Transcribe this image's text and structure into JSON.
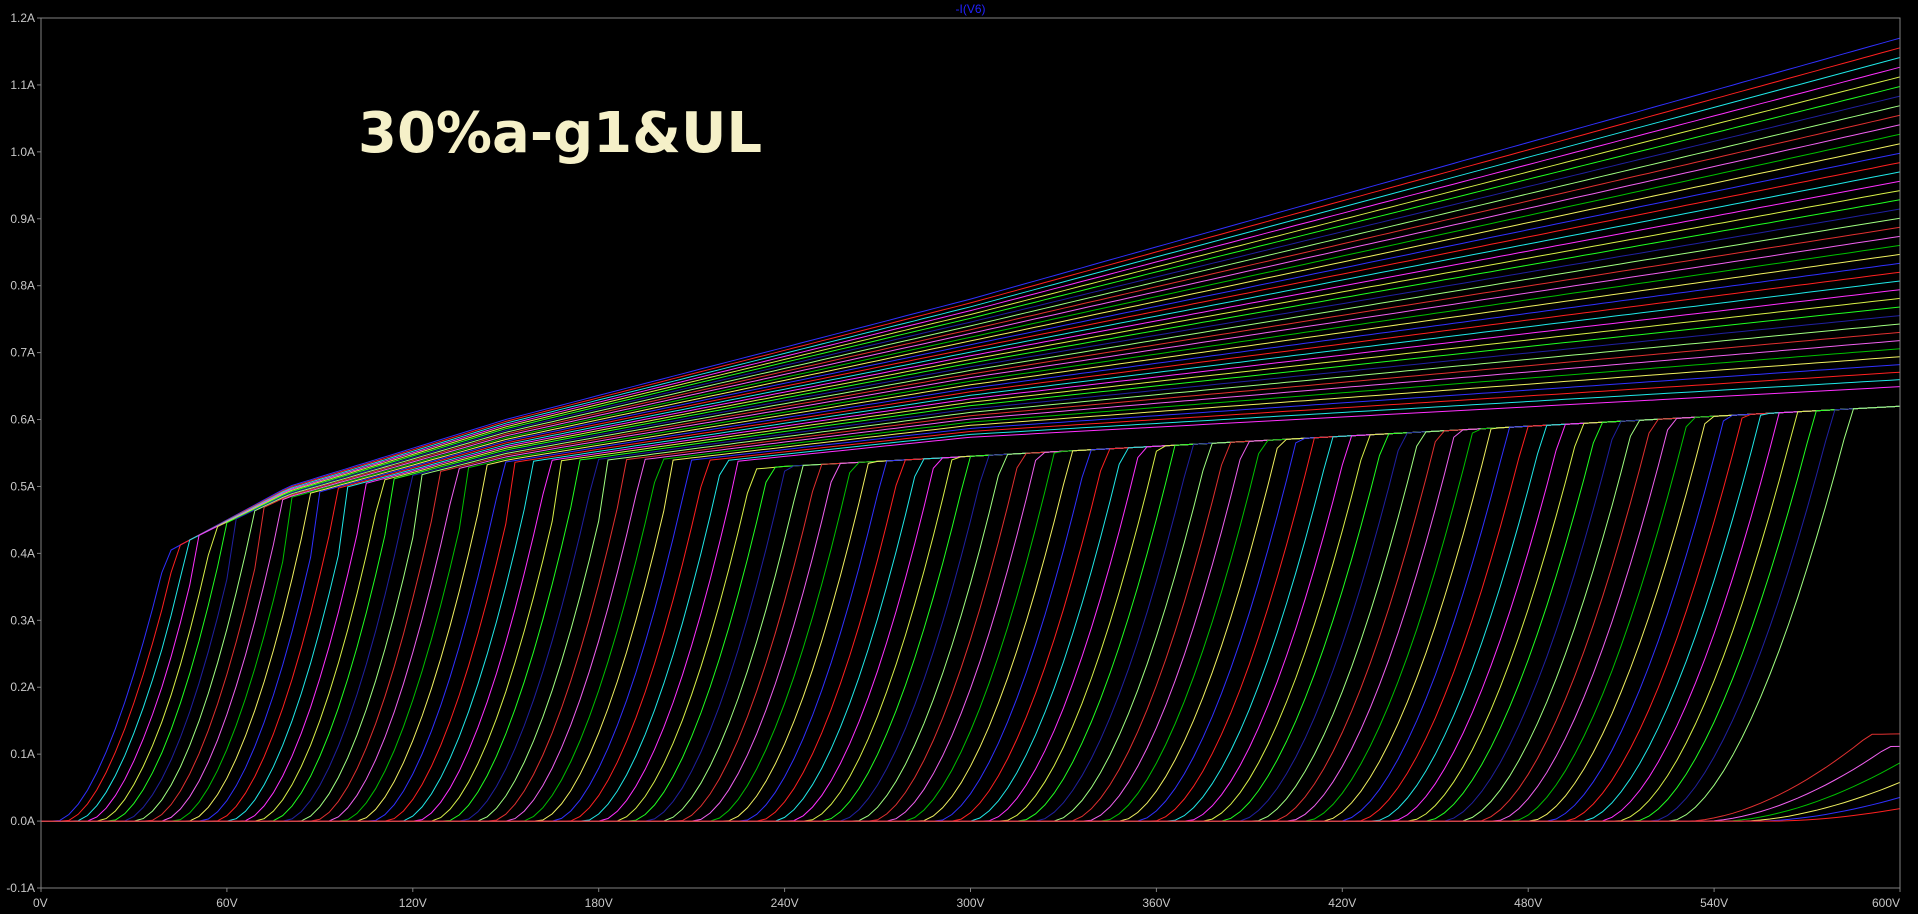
{
  "chart_data": {
    "type": "line",
    "title": "-I(V6)",
    "annotation": "30%a-g1&UL",
    "xlabel": "",
    "ylabel": "",
    "xlim": [
      0,
      600
    ],
    "ylim": [
      -0.1,
      1.2
    ],
    "x_ticks": [
      {
        "value": 0,
        "label": "0V"
      },
      {
        "value": 60,
        "label": "60V"
      },
      {
        "value": 120,
        "label": "120V"
      },
      {
        "value": 180,
        "label": "180V"
      },
      {
        "value": 240,
        "label": "240V"
      },
      {
        "value": 300,
        "label": "300V"
      },
      {
        "value": 360,
        "label": "360V"
      },
      {
        "value": 420,
        "label": "420V"
      },
      {
        "value": 480,
        "label": "480V"
      },
      {
        "value": 540,
        "label": "540V"
      },
      {
        "value": 600,
        "label": "600V"
      }
    ],
    "y_ticks": [
      {
        "value": -0.1,
        "label": "-0.1A"
      },
      {
        "value": 0.0,
        "label": "0.0A"
      },
      {
        "value": 0.1,
        "label": "0.1A"
      },
      {
        "value": 0.2,
        "label": "0.2A"
      },
      {
        "value": 0.3,
        "label": "0.3A"
      },
      {
        "value": 0.4,
        "label": "0.4A"
      },
      {
        "value": 0.5,
        "label": "0.5A"
      },
      {
        "value": 0.6,
        "label": "0.6A"
      },
      {
        "value": 0.7,
        "label": "0.7A"
      },
      {
        "value": 0.8,
        "label": "0.8A"
      },
      {
        "value": 0.9,
        "label": "0.9A"
      },
      {
        "value": 1.0,
        "label": "1.0A"
      },
      {
        "value": 1.1,
        "label": "1.1A"
      },
      {
        "value": 1.2,
        "label": "1.2A"
      }
    ],
    "grid": false,
    "background": "#000000",
    "plot_border_color": "#808080",
    "series_colors": [
      "#3030ff",
      "#ff2020",
      "#20e8e8",
      "#ff30ff",
      "#d8f048",
      "#20ff20",
      "#2020a0",
      "#a0ff80",
      "#e03030",
      "#f060f0",
      "#00c000",
      "#f0f060"
    ],
    "series_model": {
      "count": 110,
      "onset_x_first": 5,
      "onset_x_last": 560,
      "cutoff_curves_from_index": 104,
      "knee": [
        {
          "x": 40,
          "y": 0.39
        },
        {
          "x": 62,
          "y": 0.42
        },
        {
          "x": 120,
          "y": 0.48
        },
        {
          "x": 240,
          "y": 0.53
        },
        {
          "x": 600,
          "y": 0.62
        }
      ],
      "envelope_top": [
        {
          "x": 40,
          "y": 0.4
        },
        {
          "x": 80,
          "y": 0.5
        },
        {
          "x": 150,
          "y": 0.6
        },
        {
          "x": 300,
          "y": 0.78
        },
        {
          "x": 600,
          "y": 1.17
        }
      ],
      "envelope_lowest": [
        {
          "x": 62,
          "y": 0.42
        },
        {
          "x": 150,
          "y": 0.5
        },
        {
          "x": 300,
          "y": 0.57
        },
        {
          "x": 600,
          "y": 0.64
        }
      ],
      "saturated_curves": 40
    }
  }
}
